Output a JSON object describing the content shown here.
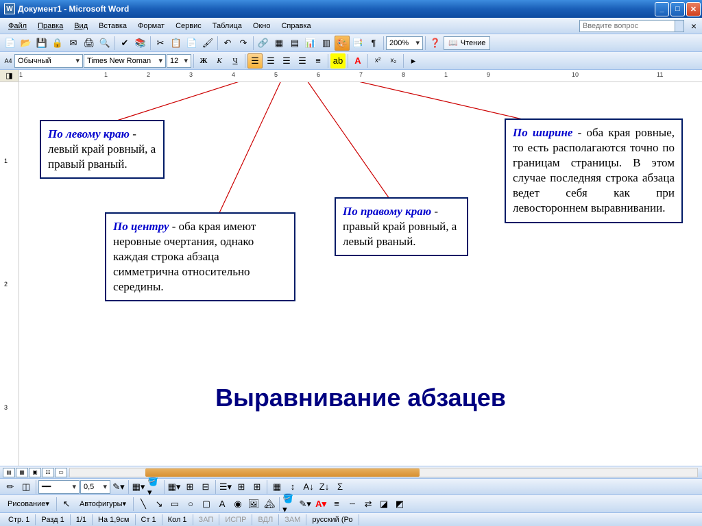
{
  "titlebar": {
    "title": "Документ1 - Microsoft Word",
    "app_icon": "W"
  },
  "menubar": {
    "items": [
      "Файл",
      "Правка",
      "Вид",
      "Вставка",
      "Формат",
      "Сервис",
      "Таблица",
      "Окно",
      "Справка"
    ],
    "help_placeholder": "Введите вопрос"
  },
  "toolbar1": {
    "zoom": "200%",
    "reading": "Чтение"
  },
  "format_toolbar": {
    "style_prefix": "A4",
    "style": "Обычный",
    "font": "Times New Roman",
    "size": "12",
    "bold": "Ж",
    "italic": "К",
    "underline": "Ч"
  },
  "ruler_marks": [
    "1",
    "",
    "1",
    "2",
    "3",
    "4",
    "5",
    "6",
    "7",
    "8",
    "1",
    "9",
    "",
    "10",
    "",
    "11"
  ],
  "v_ruler_marks": [
    "",
    "1",
    "",
    "2",
    "",
    "3"
  ],
  "callouts": {
    "left": {
      "term": "По левому краю",
      "text": " - левый край ровный, а правый рваный."
    },
    "center": {
      "term": "По центру",
      "text": " - оба края имеют неровные очертания, однако каждая строка абзаца симметрична относительно середины."
    },
    "right": {
      "term": "По правому краю",
      "text": " - правый край ровный, а левый рваный."
    },
    "justify": {
      "term": "По ширине",
      "text": " - оба края ровные, то есть располагаются точно по границам страницы. В этом случае последняя строка абзаца ведет себя как при левостороннем выравнивании."
    }
  },
  "main_title": "Выравнивание абзацев",
  "bottom_toolbar": {
    "line_weight": "0,5"
  },
  "draw_toolbar": {
    "label": "Рисование",
    "autoshapes": "Автофигуры"
  },
  "statusbar": {
    "page": "Стр. 1",
    "section": "Разд 1",
    "pages": "1/1",
    "position": "На 1,9см",
    "line": "Ст 1",
    "col": "Кол 1",
    "rec": "ЗАП",
    "trk": "ИСПР",
    "ext": "ВДЛ",
    "ovr": "ЗАМ",
    "lang": "русский (Ро"
  }
}
